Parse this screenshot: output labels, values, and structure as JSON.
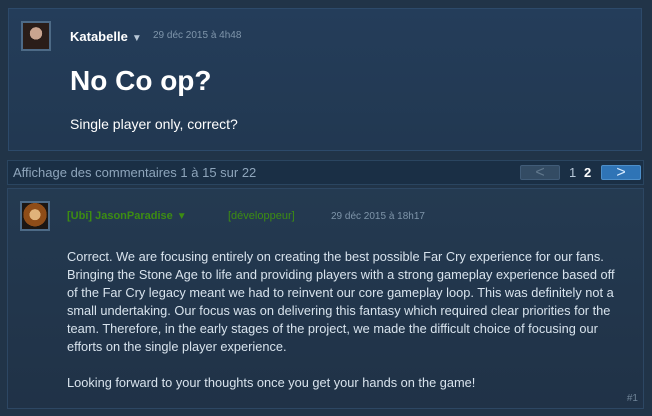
{
  "topic": {
    "author": "Katabelle",
    "date": "29 déc 2015 à 4h48",
    "title": "No Co op?",
    "body": "Single player only, correct?"
  },
  "pager": {
    "summary": "Affichage des commentaires 1 à 15 sur 22",
    "prev": "<",
    "pages": [
      "1",
      "2"
    ],
    "next": ">"
  },
  "comment": {
    "author": "[Ubi] JasonParadise",
    "role": "[développeur]",
    "date": "29 déc 2015 à 18h17",
    "paragraphs": [
      "Correct. We are focusing entirely on creating the best possible Far Cry experience for our fans. Bringing the Stone Age to life and providing players with a strong gameplay experience based off of the Far Cry legacy meant we had to reinvent our core gameplay loop. This was definitely not a small undertaking. Our focus was on delivering this fantasy which required clear priorities for the team. Therefore, in the early stages of the project, we made the difficult choice of focusing our efforts on the single player experience.",
      "Looking forward to your thoughts once you get your hands on the game!"
    ],
    "index": "#1"
  }
}
